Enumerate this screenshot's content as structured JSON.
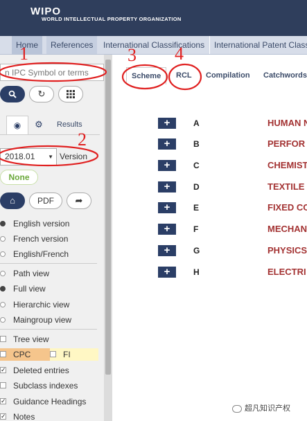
{
  "header": {
    "logo_title": "WIPO",
    "logo_subtitle": "WORLD INTELLECTUAL PROPERTY ORGANIZATION"
  },
  "nav": {
    "home": "Home",
    "references": "References",
    "international_classifications": "International Classifications",
    "international_patent_classification": "International Patent Classi"
  },
  "sidebar": {
    "search_placeholder": "n IPC Symbol or terms",
    "results_tab": "Results",
    "version_value": "2018.01",
    "version_label": "Version",
    "none_badge": "None",
    "pdf_button": "PDF",
    "language_options": [
      {
        "label": "English version",
        "selected": true
      },
      {
        "label": "French version",
        "selected": false
      },
      {
        "label": "English/French",
        "selected": false
      }
    ],
    "view_options": [
      {
        "label": "Path view",
        "selected": false
      },
      {
        "label": "Full view",
        "selected": true
      },
      {
        "label": "Hierarchic view",
        "selected": false
      },
      {
        "label": "Maingroup view",
        "selected": false
      }
    ],
    "tree_view": {
      "label": "Tree view",
      "checked": false
    },
    "cpc": {
      "label": "CPC",
      "checked": false
    },
    "fi": {
      "label": "FI",
      "checked": false
    },
    "checkbox_options": [
      {
        "label": "Deleted entries",
        "checked": true
      },
      {
        "label": "Subclass indexes",
        "checked": false
      },
      {
        "label": "Guidance Headings",
        "checked": true
      },
      {
        "label": "Notes",
        "checked": true
      }
    ]
  },
  "scheme_tabs": {
    "scheme": "Scheme",
    "rcl": "RCL",
    "compilation": "Compilation",
    "catchwords": "Catchwords"
  },
  "sections": [
    {
      "code": "A",
      "title": "HUMAN N"
    },
    {
      "code": "B",
      "title": "PERFOR"
    },
    {
      "code": "C",
      "title": "CHEMIST"
    },
    {
      "code": "D",
      "title": "TEXTILE"
    },
    {
      "code": "E",
      "title": "FIXED CO"
    },
    {
      "code": "F",
      "title": "MECHAN"
    },
    {
      "code": "G",
      "title": "PHYSICS"
    },
    {
      "code": "H",
      "title": "ELECTRI"
    }
  ],
  "annotations": {
    "n1": "1",
    "n2": "2",
    "n3": "3",
    "n4": "4",
    "color": "#e02020"
  },
  "watermark": "超凡知识产权",
  "colors": {
    "header_bg": "#2f3e5c",
    "accent_navy": "#2b3e66",
    "section_title_red": "#a33232",
    "none_green": "#6aa83a"
  }
}
